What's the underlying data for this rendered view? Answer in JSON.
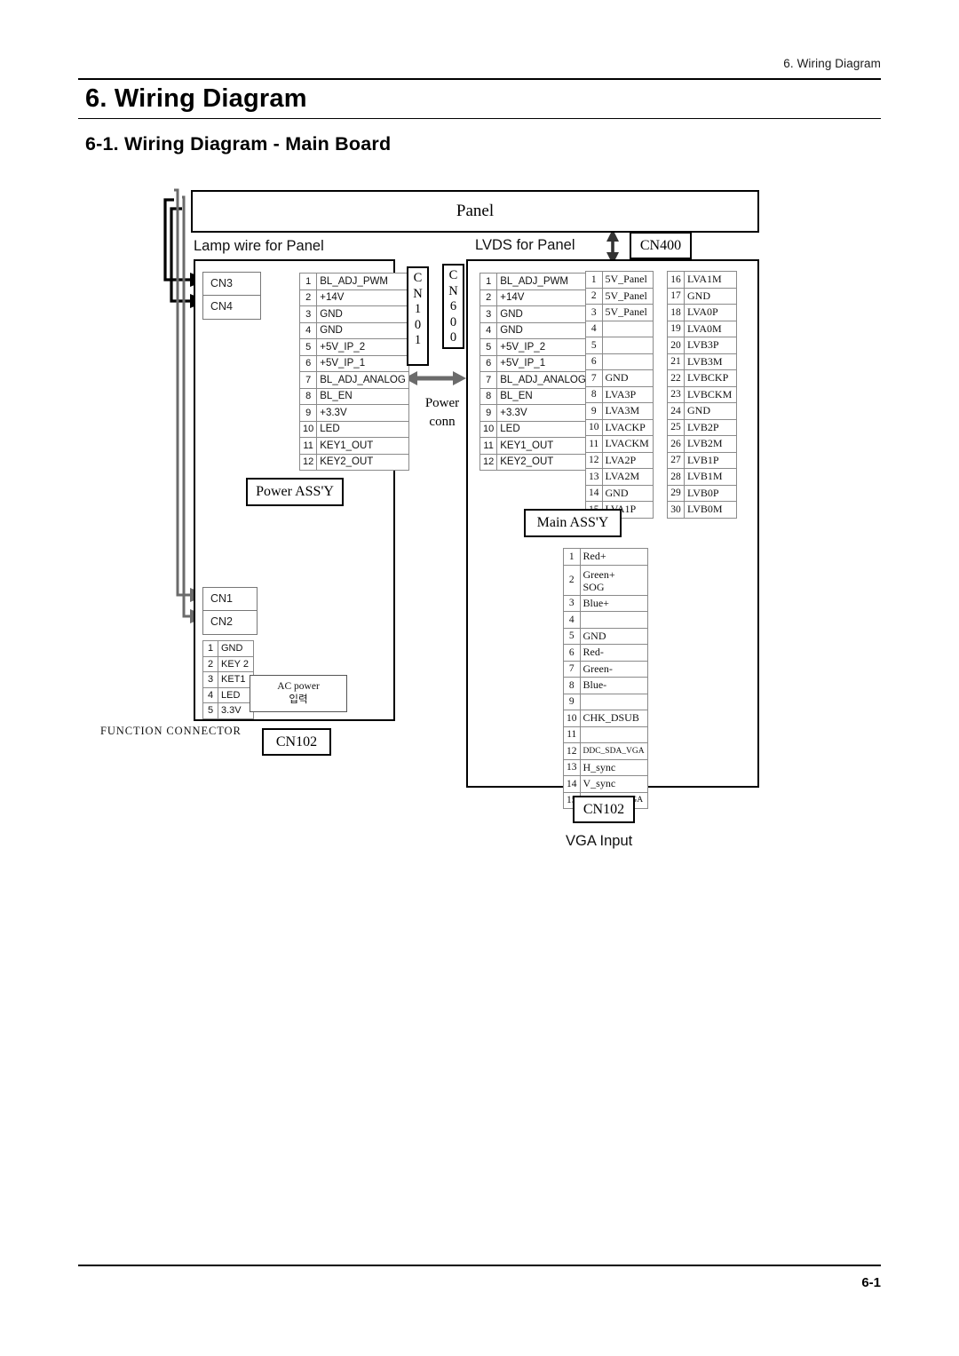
{
  "page": {
    "header_right": "6. Wiring Diagram",
    "chapter_title": "6. Wiring Diagram",
    "section_title": "6-1. Wiring Diagram - Main Board",
    "footer_page": "6-1"
  },
  "diagram": {
    "panel_label": "Panel",
    "lamp_wire_caption": "Lamp wire for Panel",
    "lvds_caption": "LVDS for Panel",
    "vga_input_caption": "VGA Input",
    "function_connector_caption": "FUNCTION CONNECTOR",
    "power_conn_label_line1": "Power",
    "power_conn_label_line2": "conn",
    "boxes": {
      "power_assy": "Power ASS'Y",
      "main_assy": "Main ASS'Y",
      "cn400": "CN400",
      "cn102_left": "CN102",
      "cn102_bottom": "CN102",
      "cn101": "CN101",
      "cn600": "CN600"
    },
    "ac_power": {
      "line1": "AC power",
      "line2": "입력"
    },
    "connectors_top": [
      "CN3",
      "CN4"
    ],
    "connectors_bottom": [
      "CN1",
      "CN2"
    ],
    "lamp_wire_pins": [
      {
        "n": "1",
        "label": "BL_ADJ_PWM"
      },
      {
        "n": "2",
        "label": "+14V"
      },
      {
        "n": "3",
        "label": "GND"
      },
      {
        "n": "4",
        "label": "GND"
      },
      {
        "n": "5",
        "label": "+5V_IP_2"
      },
      {
        "n": "6",
        "label": "+5V_IP_1"
      },
      {
        "n": "7",
        "label": "BL_ADJ_ANALOG"
      },
      {
        "n": "8",
        "label": "BL_EN"
      },
      {
        "n": "9",
        "label": "+3.3V"
      },
      {
        "n": "10",
        "label": "LED"
      },
      {
        "n": "11",
        "label": "KEY1_OUT"
      },
      {
        "n": "12",
        "label": "KEY2_OUT"
      }
    ],
    "lvds_power_pins": [
      {
        "n": "1",
        "label": "BL_ADJ_PWM"
      },
      {
        "n": "2",
        "label": "+14V"
      },
      {
        "n": "3",
        "label": "GND"
      },
      {
        "n": "4",
        "label": "GND"
      },
      {
        "n": "5",
        "label": "+5V_IP_2"
      },
      {
        "n": "6",
        "label": "+5V_IP_1"
      },
      {
        "n": "7",
        "label": "BL_ADJ_ANALOG"
      },
      {
        "n": "8",
        "label": "BL_EN"
      },
      {
        "n": "9",
        "label": "+3.3V"
      },
      {
        "n": "10",
        "label": "LED"
      },
      {
        "n": "11",
        "label": "KEY1_OUT"
      },
      {
        "n": "12",
        "label": "KEY2_OUT"
      }
    ],
    "lvds_pins_left": [
      {
        "n": "1",
        "label": "5V_Panel"
      },
      {
        "n": "2",
        "label": "5V_Panel"
      },
      {
        "n": "3",
        "label": "5V_Panel"
      },
      {
        "n": "4",
        "label": ""
      },
      {
        "n": "5",
        "label": ""
      },
      {
        "n": "6",
        "label": ""
      },
      {
        "n": "7",
        "label": "GND"
      },
      {
        "n": "8",
        "label": "LVA3P"
      },
      {
        "n": "9",
        "label": "LVA3M"
      },
      {
        "n": "10",
        "label": "LVACKP"
      },
      {
        "n": "11",
        "label": "LVACKM"
      },
      {
        "n": "12",
        "label": "LVA2P"
      },
      {
        "n": "13",
        "label": "LVA2M"
      },
      {
        "n": "14",
        "label": "GND"
      },
      {
        "n": "15",
        "label": "LVA1P"
      }
    ],
    "lvds_pins_right": [
      {
        "n": "16",
        "label": "LVA1M"
      },
      {
        "n": "17",
        "label": "GND"
      },
      {
        "n": "18",
        "label": "LVA0P"
      },
      {
        "n": "19",
        "label": "LVA0M"
      },
      {
        "n": "20",
        "label": "LVB3P"
      },
      {
        "n": "21",
        "label": "LVB3M"
      },
      {
        "n": "22",
        "label": "LVBCKP"
      },
      {
        "n": "23",
        "label": "LVBCKM"
      },
      {
        "n": "24",
        "label": "GND"
      },
      {
        "n": "25",
        "label": "LVB2P"
      },
      {
        "n": "26",
        "label": "LVB2M"
      },
      {
        "n": "27",
        "label": "LVB1P"
      },
      {
        "n": "28",
        "label": "LVB1M"
      },
      {
        "n": "29",
        "label": "LVB0P"
      },
      {
        "n": "30",
        "label": "LVB0M"
      }
    ],
    "vga_pins": [
      {
        "n": "1",
        "label": "Red+"
      },
      {
        "n": "2",
        "label": "Green+\nSOG",
        "tall": true
      },
      {
        "n": "3",
        "label": "Blue+"
      },
      {
        "n": "4",
        "label": ""
      },
      {
        "n": "5",
        "label": "GND"
      },
      {
        "n": "6",
        "label": "Red-"
      },
      {
        "n": "7",
        "label": "Green-"
      },
      {
        "n": "8",
        "label": "Blue-"
      },
      {
        "n": "9",
        "label": ""
      },
      {
        "n": "10",
        "label": "CHK_DSUB"
      },
      {
        "n": "11",
        "label": ""
      },
      {
        "n": "12",
        "label": "DDC_SDA_VGA",
        "small": true
      },
      {
        "n": "13",
        "label": "H_sync"
      },
      {
        "n": "14",
        "label": "V_sync"
      },
      {
        "n": "15",
        "label": "DDC_SCL_VGA",
        "small": true
      }
    ],
    "function_pins": [
      {
        "n": "1",
        "label": "GND"
      },
      {
        "n": "2",
        "label": "KEY 2"
      },
      {
        "n": "3",
        "label": "KET1"
      },
      {
        "n": "4",
        "label": "LED"
      },
      {
        "n": "5",
        "label": "3.3V"
      }
    ]
  },
  "colors": {
    "ink": "#000000",
    "wire_black": "#000000",
    "wire_gray": "#6b6b6b",
    "rule": "#000000"
  }
}
